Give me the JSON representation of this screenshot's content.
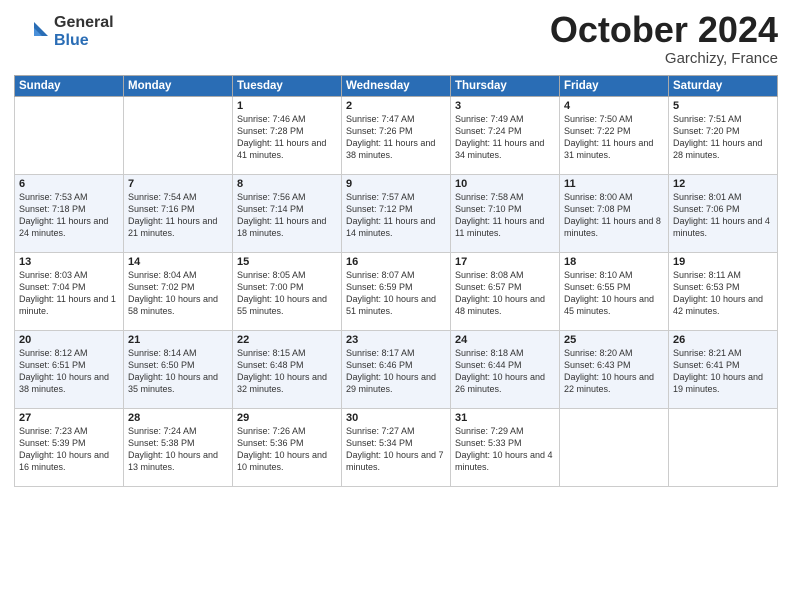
{
  "header": {
    "logo_general": "General",
    "logo_blue": "Blue",
    "month": "October 2024",
    "location": "Garchizy, France"
  },
  "days_of_week": [
    "Sunday",
    "Monday",
    "Tuesday",
    "Wednesday",
    "Thursday",
    "Friday",
    "Saturday"
  ],
  "weeks": [
    [
      {
        "day": "",
        "info": ""
      },
      {
        "day": "",
        "info": ""
      },
      {
        "day": "1",
        "info": "Sunrise: 7:46 AM\nSunset: 7:28 PM\nDaylight: 11 hours and 41 minutes."
      },
      {
        "day": "2",
        "info": "Sunrise: 7:47 AM\nSunset: 7:26 PM\nDaylight: 11 hours and 38 minutes."
      },
      {
        "day": "3",
        "info": "Sunrise: 7:49 AM\nSunset: 7:24 PM\nDaylight: 11 hours and 34 minutes."
      },
      {
        "day": "4",
        "info": "Sunrise: 7:50 AM\nSunset: 7:22 PM\nDaylight: 11 hours and 31 minutes."
      },
      {
        "day": "5",
        "info": "Sunrise: 7:51 AM\nSunset: 7:20 PM\nDaylight: 11 hours and 28 minutes."
      }
    ],
    [
      {
        "day": "6",
        "info": "Sunrise: 7:53 AM\nSunset: 7:18 PM\nDaylight: 11 hours and 24 minutes."
      },
      {
        "day": "7",
        "info": "Sunrise: 7:54 AM\nSunset: 7:16 PM\nDaylight: 11 hours and 21 minutes."
      },
      {
        "day": "8",
        "info": "Sunrise: 7:56 AM\nSunset: 7:14 PM\nDaylight: 11 hours and 18 minutes."
      },
      {
        "day": "9",
        "info": "Sunrise: 7:57 AM\nSunset: 7:12 PM\nDaylight: 11 hours and 14 minutes."
      },
      {
        "day": "10",
        "info": "Sunrise: 7:58 AM\nSunset: 7:10 PM\nDaylight: 11 hours and 11 minutes."
      },
      {
        "day": "11",
        "info": "Sunrise: 8:00 AM\nSunset: 7:08 PM\nDaylight: 11 hours and 8 minutes."
      },
      {
        "day": "12",
        "info": "Sunrise: 8:01 AM\nSunset: 7:06 PM\nDaylight: 11 hours and 4 minutes."
      }
    ],
    [
      {
        "day": "13",
        "info": "Sunrise: 8:03 AM\nSunset: 7:04 PM\nDaylight: 11 hours and 1 minute."
      },
      {
        "day": "14",
        "info": "Sunrise: 8:04 AM\nSunset: 7:02 PM\nDaylight: 10 hours and 58 minutes."
      },
      {
        "day": "15",
        "info": "Sunrise: 8:05 AM\nSunset: 7:00 PM\nDaylight: 10 hours and 55 minutes."
      },
      {
        "day": "16",
        "info": "Sunrise: 8:07 AM\nSunset: 6:59 PM\nDaylight: 10 hours and 51 minutes."
      },
      {
        "day": "17",
        "info": "Sunrise: 8:08 AM\nSunset: 6:57 PM\nDaylight: 10 hours and 48 minutes."
      },
      {
        "day": "18",
        "info": "Sunrise: 8:10 AM\nSunset: 6:55 PM\nDaylight: 10 hours and 45 minutes."
      },
      {
        "day": "19",
        "info": "Sunrise: 8:11 AM\nSunset: 6:53 PM\nDaylight: 10 hours and 42 minutes."
      }
    ],
    [
      {
        "day": "20",
        "info": "Sunrise: 8:12 AM\nSunset: 6:51 PM\nDaylight: 10 hours and 38 minutes."
      },
      {
        "day": "21",
        "info": "Sunrise: 8:14 AM\nSunset: 6:50 PM\nDaylight: 10 hours and 35 minutes."
      },
      {
        "day": "22",
        "info": "Sunrise: 8:15 AM\nSunset: 6:48 PM\nDaylight: 10 hours and 32 minutes."
      },
      {
        "day": "23",
        "info": "Sunrise: 8:17 AM\nSunset: 6:46 PM\nDaylight: 10 hours and 29 minutes."
      },
      {
        "day": "24",
        "info": "Sunrise: 8:18 AM\nSunset: 6:44 PM\nDaylight: 10 hours and 26 minutes."
      },
      {
        "day": "25",
        "info": "Sunrise: 8:20 AM\nSunset: 6:43 PM\nDaylight: 10 hours and 22 minutes."
      },
      {
        "day": "26",
        "info": "Sunrise: 8:21 AM\nSunset: 6:41 PM\nDaylight: 10 hours and 19 minutes."
      }
    ],
    [
      {
        "day": "27",
        "info": "Sunrise: 7:23 AM\nSunset: 5:39 PM\nDaylight: 10 hours and 16 minutes."
      },
      {
        "day": "28",
        "info": "Sunrise: 7:24 AM\nSunset: 5:38 PM\nDaylight: 10 hours and 13 minutes."
      },
      {
        "day": "29",
        "info": "Sunrise: 7:26 AM\nSunset: 5:36 PM\nDaylight: 10 hours and 10 minutes."
      },
      {
        "day": "30",
        "info": "Sunrise: 7:27 AM\nSunset: 5:34 PM\nDaylight: 10 hours and 7 minutes."
      },
      {
        "day": "31",
        "info": "Sunrise: 7:29 AM\nSunset: 5:33 PM\nDaylight: 10 hours and 4 minutes."
      },
      {
        "day": "",
        "info": ""
      },
      {
        "day": "",
        "info": ""
      }
    ]
  ]
}
